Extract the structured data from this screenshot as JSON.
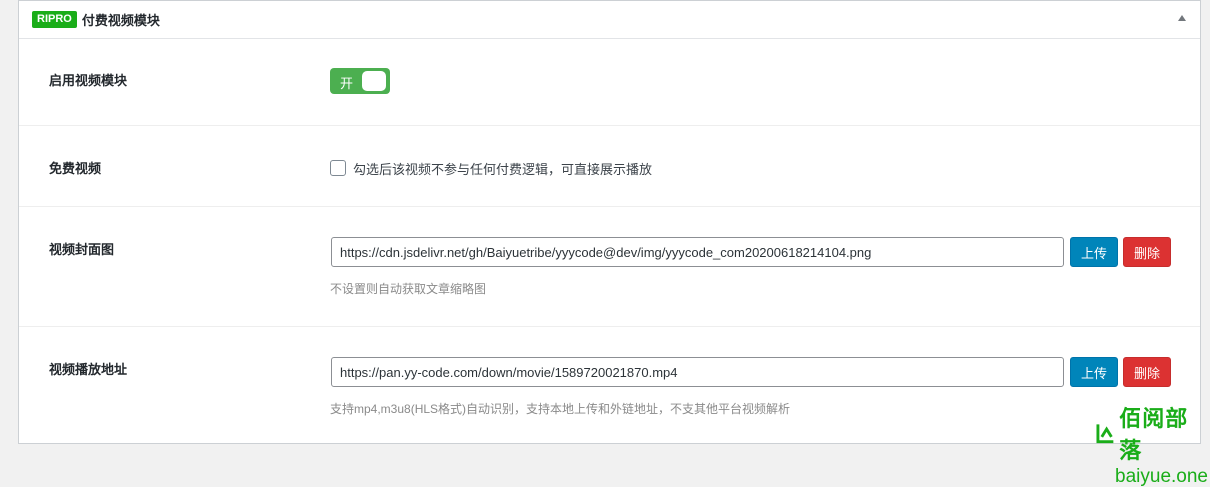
{
  "panel": {
    "badge": "RIPRO",
    "title": "付费视频模块"
  },
  "rows": {
    "enable": {
      "label": "启用视频模块",
      "toggle_text": "开",
      "toggle_on": true
    },
    "free": {
      "label": "免费视频",
      "checkbox_label": "勾选后该视频不参与任何付费逻辑，可直接展示播放",
      "checked": false
    },
    "cover": {
      "label": "视频封面图",
      "value": "https://cdn.jsdelivr.net/gh/Baiyuetribe/yyycode@dev/img/yyycode_com20200618214104.png",
      "upload_label": "上传",
      "delete_label": "删除",
      "description": "不设置则自动获取文章缩略图"
    },
    "video": {
      "label": "视频播放地址",
      "value": "https://pan.yy-code.com/down/movie/1589720021870.mp4",
      "upload_label": "上传",
      "delete_label": "删除",
      "description": "支持mp4,m3u8(HLS格式)自动识别，支持本地上传和外链地址，不支其他平台视频解析"
    }
  },
  "watermark": {
    "cn": "佰阅部落",
    "en": "baiyue.one"
  },
  "colors": {
    "badge": "#1aad19",
    "toggle_on": "#4caf50",
    "upload": "#0085ba",
    "delete": "#dc3232"
  }
}
